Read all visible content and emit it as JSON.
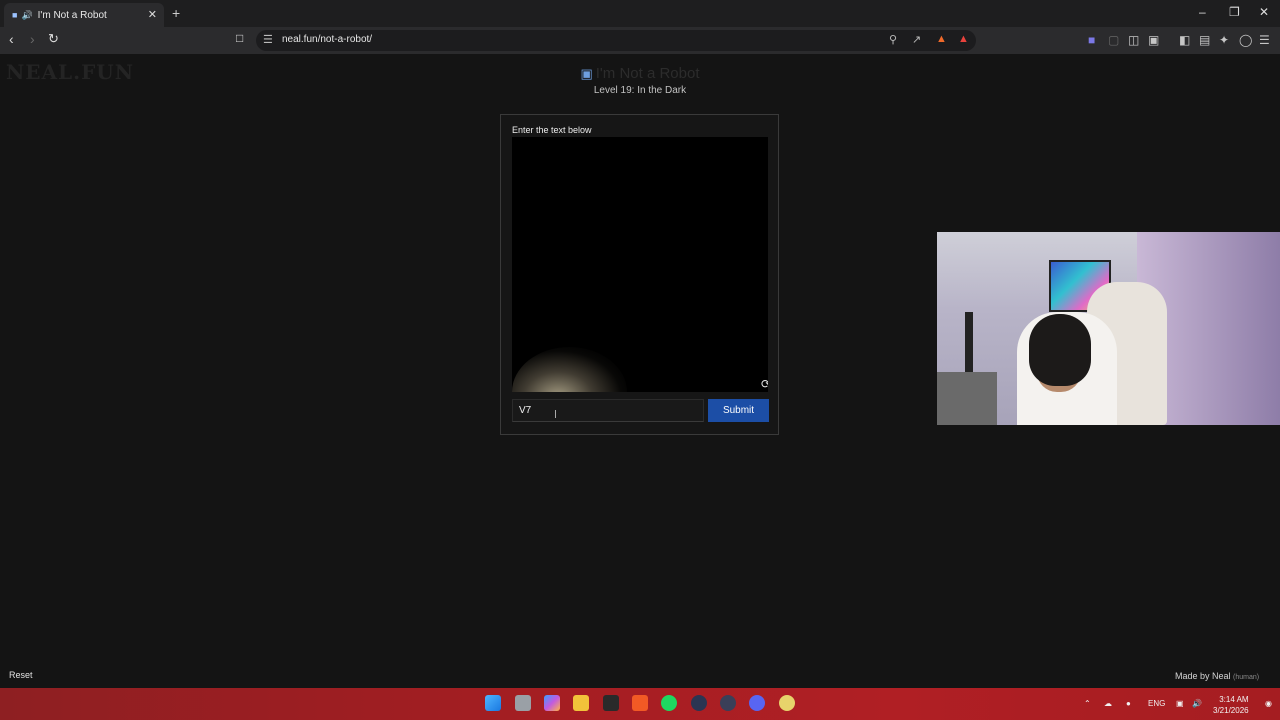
{
  "browser": {
    "tab_title": "I'm Not a Robot",
    "url": "neal.fun/not-a-robot/",
    "new_tab_symbol": "+",
    "icons": [
      "back-icon",
      "forward-icon",
      "reload-icon",
      "bookmark-icon",
      "site-info-icon",
      "zoom-icon",
      "share-icon",
      "brave-shields-icon",
      "brave-rewards-icon",
      "extensions-icon",
      "sidebar-icon",
      "wallet-icon",
      "leo-icon",
      "vpn-icon",
      "menu-icon"
    ]
  },
  "page": {
    "site_logo": "NEAL.FUN",
    "title": "I'm Not a Robot",
    "subtitle": "Level 19: In the Dark",
    "captcha": {
      "label": "Enter the text below",
      "input_value": "V7",
      "submit_label": "Submit"
    },
    "reset_label": "Reset",
    "made_by": "Made by Neal",
    "made_by_note": "(human)"
  },
  "taskbar": {
    "language": "ENG",
    "time": "3:14 AM",
    "date": "3/21/2026",
    "apps": [
      "windows-start",
      "task-view",
      "copilot",
      "file-explorer",
      "media-editor",
      "brave",
      "spotify",
      "terminal",
      "obs",
      "discord",
      "chrome-canary"
    ]
  },
  "colors": {
    "taskbar": "#a11e22",
    "submit_button": "#1c4ea6",
    "page_background": "#141414"
  }
}
